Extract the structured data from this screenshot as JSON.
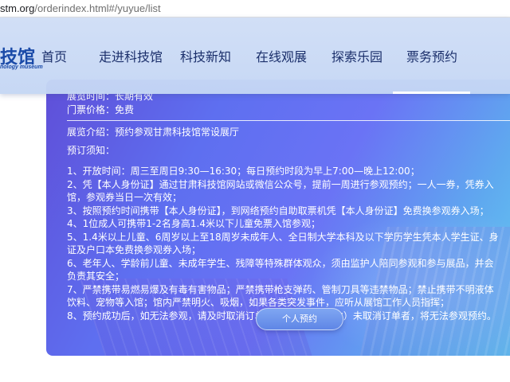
{
  "browser": {
    "url_host": "stm.org",
    "url_path": "/orderindex.html#/yuyue/list"
  },
  "header": {
    "logo_text": "技馆",
    "logo_subtext": "nology museum",
    "nav": [
      "首页",
      "走进科技馆",
      "科技新知",
      "在线观展",
      "探索乐园",
      "票务预约"
    ],
    "active_index": 5
  },
  "content": {
    "open_time_cut": "展览时间：长期有效",
    "price": "门票价格：免费",
    "intro": "展览介绍：预约参观甘肃科技馆常设展厅",
    "notice_title": "预订须知：",
    "lines": [
      "1、开放时间：周三至周日9:30—16:30；每日预约时段为早上7:00—晚上12:00；",
      "2、凭【本人身份证】通过甘肃科技馆网站或微信公众号，提前一周进行参观预约；一人一券，凭券入",
      "馆，参观券当日一次有效；",
      "3、按照预约时间携带【本人身份证】，到网络预约自助取票机凭【本人身份证】免费换参观券入场；",
      "4、1位成人可携带1-2名身高1.4米以下儿童免票入馆参观；",
      "5、1.4米以上儿童、6周岁以上至18周岁未成年人、全日制大学本科及以下学历学生凭本人学生证、身",
      "证及户口本免费换参观券入场；",
      "6、老年人、学龄前儿童、未成年学生、残障等特殊群体观众，须由监护人陪同参观和参与展品，并会",
      "负责其安全；",
      "7、严禁携带易燃易爆及有毒有害物品；严禁携带枪支弹药、管制刀具等违禁物品；禁止携带不明液体",
      "饮料、宠物等入馆；馆内严禁明火、吸烟，如果各类突发事件，应听从展馆工作人员指挥；",
      "8、预约成功后，如无法参观，请及时取消订单；超过2次（含2次）未取消订单者，将无法参观预约。"
    ],
    "button_label": "个人预约"
  }
}
